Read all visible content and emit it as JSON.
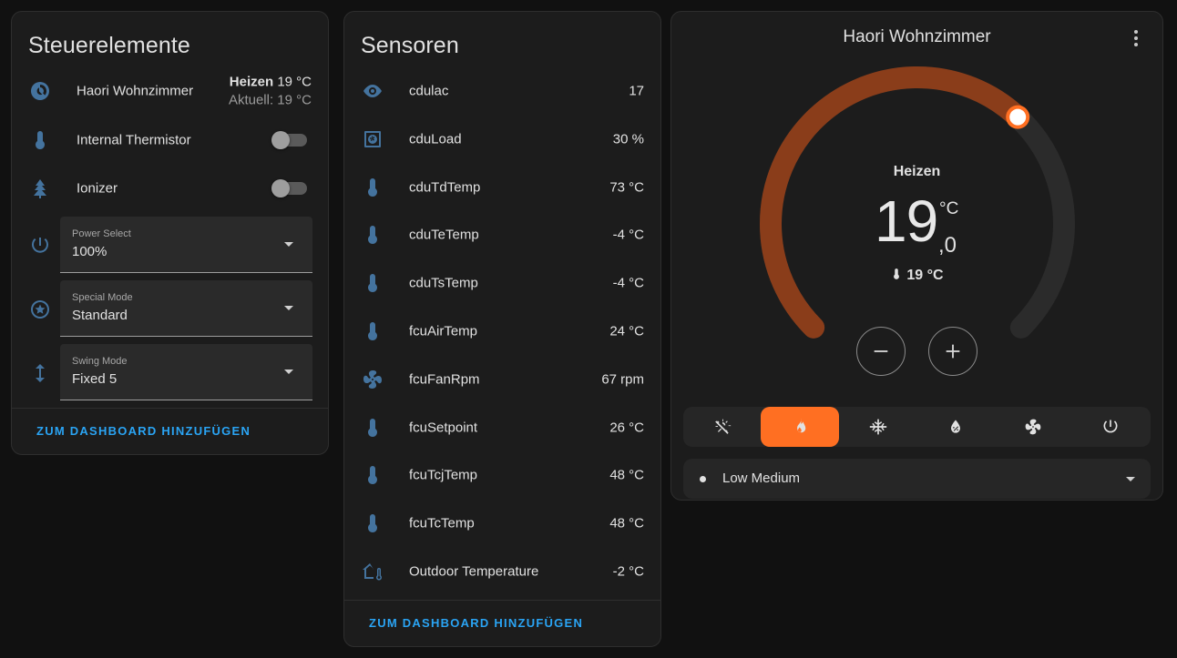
{
  "controls": {
    "title": "Steuerelemente",
    "climate": {
      "name": "Haori Wohnzimmer",
      "state_label": "Heizen",
      "target": "19 °C",
      "current": "Aktuell: 19 °C"
    },
    "switches": [
      {
        "name": "Internal Thermistor",
        "on": false,
        "icon": "thermometer-icon"
      },
      {
        "name": "Ionizer",
        "on": false,
        "icon": "pine-tree-icon"
      }
    ],
    "selects": [
      {
        "label": "Power Select",
        "value": "100%",
        "icon": "power-icon"
      },
      {
        "label": "Special Mode",
        "value": "Standard",
        "icon": "star-circle-icon"
      },
      {
        "label": "Swing Mode",
        "value": "Fixed 5",
        "icon": "arrow-up-down-icon"
      }
    ],
    "footer": "ZUM DASHBOARD HINZUFÜGEN"
  },
  "sensors": {
    "title": "Sensoren",
    "items": [
      {
        "name": "cdulac",
        "value": "17",
        "icon": "eye-icon"
      },
      {
        "name": "cduLoad",
        "value": "30 %",
        "icon": "hvac-icon"
      },
      {
        "name": "cduTdTemp",
        "value": "73 °C",
        "icon": "thermometer-icon"
      },
      {
        "name": "cduTeTemp",
        "value": "-4 °C",
        "icon": "thermometer-icon"
      },
      {
        "name": "cduTsTemp",
        "value": "-4 °C",
        "icon": "thermometer-icon"
      },
      {
        "name": "fcuAirTemp",
        "value": "24 °C",
        "icon": "thermometer-icon"
      },
      {
        "name": "fcuFanRpm",
        "value": "67 rpm",
        "icon": "fan-icon"
      },
      {
        "name": "fcuSetpoint",
        "value": "26 °C",
        "icon": "thermometer-icon"
      },
      {
        "name": "fcuTcjTemp",
        "value": "48 °C",
        "icon": "thermometer-icon"
      },
      {
        "name": "fcuTcTemp",
        "value": "48 °C",
        "icon": "thermometer-icon"
      },
      {
        "name": "Outdoor Temperature",
        "value": "-2 °C",
        "icon": "home-thermometer-icon"
      }
    ],
    "footer": "ZUM DASHBOARD HINZUFÜGEN"
  },
  "thermostat": {
    "title": "Haori Wohnzimmer",
    "mode_label": "Heizen",
    "target_int": "19",
    "target_dec": ",0",
    "unit": "°C",
    "current": "19 °C",
    "target_fraction": 0.66,
    "colors": {
      "heat": "#ff6f22",
      "heat_track": "#8a3d1a",
      "track": "#2b2b2b"
    },
    "modes": [
      {
        "name": "auto",
        "icon": "sun-snowflake-icon",
        "active": false
      },
      {
        "name": "heat",
        "icon": "fire-icon",
        "active": true
      },
      {
        "name": "cool",
        "icon": "snowflake-icon",
        "active": false
      },
      {
        "name": "dry",
        "icon": "water-percent-icon",
        "active": false
      },
      {
        "name": "fan_only",
        "icon": "fan-icon",
        "active": false
      },
      {
        "name": "off",
        "icon": "power-icon",
        "active": false
      }
    ],
    "fan_mode": "Low Medium"
  }
}
